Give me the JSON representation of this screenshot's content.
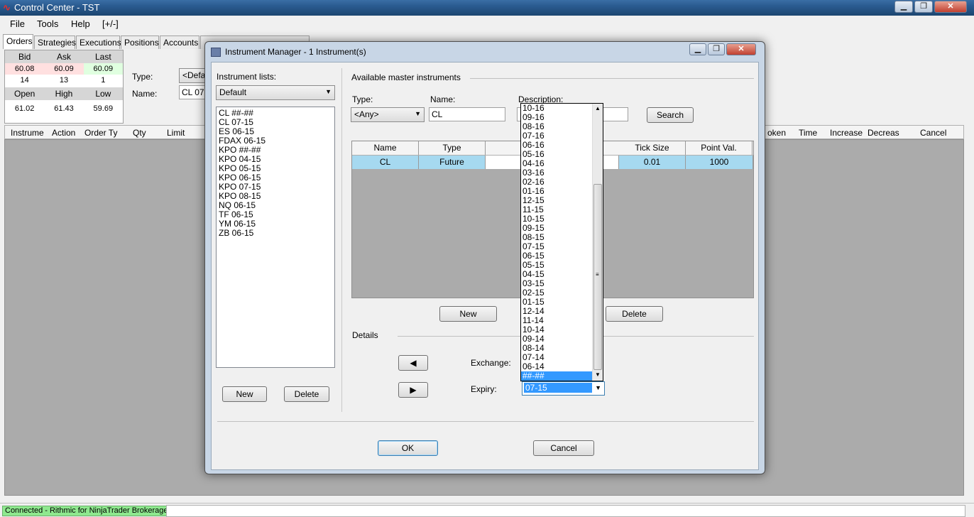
{
  "window": {
    "title": "Control Center - TST"
  },
  "menu": [
    "File",
    "Tools",
    "Help",
    "[+/-]"
  ],
  "tabs": [
    "Orders",
    "Strategies",
    "Executions",
    "Positions",
    "Accounts"
  ],
  "quote": {
    "headers1": [
      "Bid",
      "Ask",
      "Last"
    ],
    "row1": [
      "60.08",
      "60.09",
      "60.09"
    ],
    "row2": [
      "14",
      "13",
      "1"
    ],
    "headers2": [
      "Open",
      "High",
      "Low"
    ],
    "row3": [
      "61.02",
      "61.43",
      "59.69"
    ],
    "bid_color": "#ffe0e0",
    "ask_color": "#ffe0e0",
    "last_color": "#e0ffe0"
  },
  "order_entry": {
    "type_label": "Type:",
    "type_value": "<Defau",
    "name_label": "Name:",
    "name_value": "CL 07-"
  },
  "orders_grid": {
    "left_columns": [
      "Instrume",
      "Action",
      "Order Ty",
      "Qty",
      "Limit"
    ],
    "right_columns": [
      "oken",
      "Time",
      "Increase",
      "Decreas",
      "Cancel"
    ]
  },
  "status": {
    "connection": "Connected - Rithmic for NinjaTrader Brokerage"
  },
  "dialog": {
    "title": "Instrument Manager - 1 Instrument(s)",
    "instrument_lists_label": "Instrument lists:",
    "list_selected": "Default",
    "instruments": [
      "CL ##-##",
      "CL 07-15",
      "ES 06-15",
      "FDAX 06-15",
      "KPO ##-##",
      "KPO 04-15",
      "KPO 05-15",
      "KPO 06-15",
      "KPO 07-15",
      "KPO 08-15",
      "NQ 06-15",
      "TF 06-15",
      "YM 06-15",
      "ZB 06-15"
    ],
    "list_new": "New",
    "list_delete": "Delete",
    "available_label": "Available master instruments",
    "type_label": "Type:",
    "type_value": "<Any>",
    "name_label": "Name:",
    "name_value": "CL",
    "description_label": "Description:",
    "search": "Search",
    "grid_headers": [
      "Name",
      "Type",
      "Tick Size",
      "Point Val."
    ],
    "grid_row": [
      "CL",
      "Future",
      "0.01",
      "1000"
    ],
    "master_new": "New",
    "master_delete": "Delete",
    "details_label": "Details",
    "exchange_label": "Exchange:",
    "expiry_label": "Expiry:",
    "expiry_value": "07-15",
    "expiry_options": [
      "10-16",
      "09-16",
      "08-16",
      "07-16",
      "06-16",
      "05-16",
      "04-16",
      "03-16",
      "02-16",
      "01-16",
      "12-15",
      "11-15",
      "10-15",
      "09-15",
      "08-15",
      "07-15",
      "06-15",
      "05-15",
      "04-15",
      "03-15",
      "02-15",
      "01-15",
      "12-14",
      "11-14",
      "10-14",
      "09-14",
      "08-14",
      "07-14",
      "06-14",
      "##-##"
    ],
    "expiry_highlighted": "##-##",
    "ok": "OK",
    "cancel": "Cancel"
  }
}
